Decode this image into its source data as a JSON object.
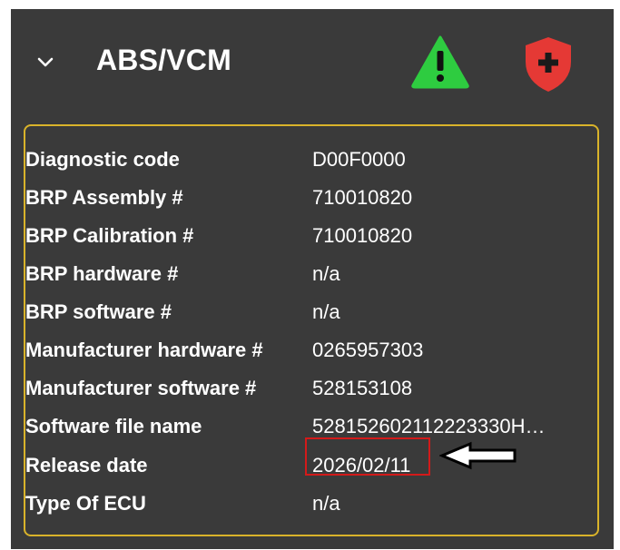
{
  "header": {
    "title": "ABS/VCM",
    "chevron_icon": "chevron-down-icon",
    "warning_icon": "warning-triangle-icon",
    "shield_icon": "shield-plus-icon",
    "warning_color": "#2ecc40",
    "shield_color": "#e53935"
  },
  "details": {
    "border_color": "#d9b32a",
    "rows": [
      {
        "label": "Diagnostic code",
        "value": "D00F0000"
      },
      {
        "label": "BRP Assembly #",
        "value": "710010820"
      },
      {
        "label": "BRP Calibration #",
        "value": "710010820"
      },
      {
        "label": "BRP hardware #",
        "value": "n/a"
      },
      {
        "label": "BRP software #",
        "value": "n/a"
      },
      {
        "label": "Manufacturer hardware #",
        "value": "0265957303"
      },
      {
        "label": "Manufacturer software #",
        "value": "528153108"
      },
      {
        "label": "Software file name",
        "value": "528152602112223330H…"
      },
      {
        "label": "Release date",
        "value": "2026/02/11"
      },
      {
        "label": "Type Of ECU",
        "value": "n/a"
      }
    ]
  },
  "annotation": {
    "highlight_color": "#d31a1a",
    "arrow_icon": "left-arrow-icon"
  }
}
